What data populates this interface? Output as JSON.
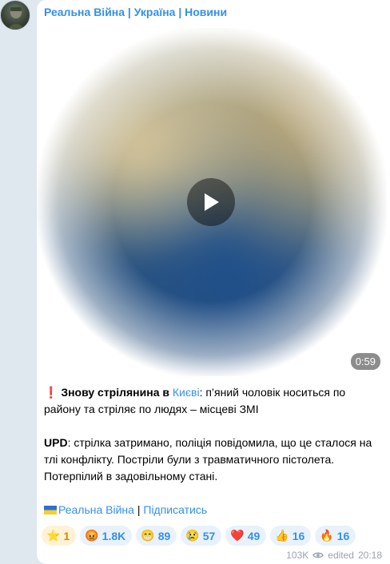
{
  "channel": {
    "name": "Реальна Війна | Україна | Новини",
    "avatar_icon": "soldier-avatar-icon"
  },
  "video": {
    "duration": "0:59"
  },
  "post": {
    "p1_mark": "❗",
    "p1_bold": "Знову стрілянина в",
    "p1_link": "Києві",
    "p1_rest": ": п’яний чоловік носиться по району та стріляє по людях – місцеві ЗМІ",
    "p2_bold": "UPD",
    "p2_rest": ": стрілка затримано, поліція повідомила, що це сталося на тлі конфлікту. Постріли були з травматичного пістолета. Потерпілий в задовільному стані.",
    "signature_link": "Реальна Війна",
    "signature_sep": " | ",
    "subscribe_link": "Підписатись"
  },
  "reactions": [
    {
      "emoji": "⭐",
      "count": "1"
    },
    {
      "emoji": "😡",
      "count": "1.8K"
    },
    {
      "emoji": "😁",
      "count": "89"
    },
    {
      "emoji": "😢",
      "count": "57"
    },
    {
      "emoji": "❤️",
      "count": "49"
    },
    {
      "emoji": "👍",
      "count": "16"
    },
    {
      "emoji": "🔥",
      "count": "16"
    }
  ],
  "footer": {
    "views": "103K",
    "edited": "edited",
    "time": "20:18"
  },
  "colors": {
    "accent": "#3390ec",
    "background": "#dfe7ef",
    "bubble": "#ffffff",
    "meta": "#9aa3ad"
  }
}
